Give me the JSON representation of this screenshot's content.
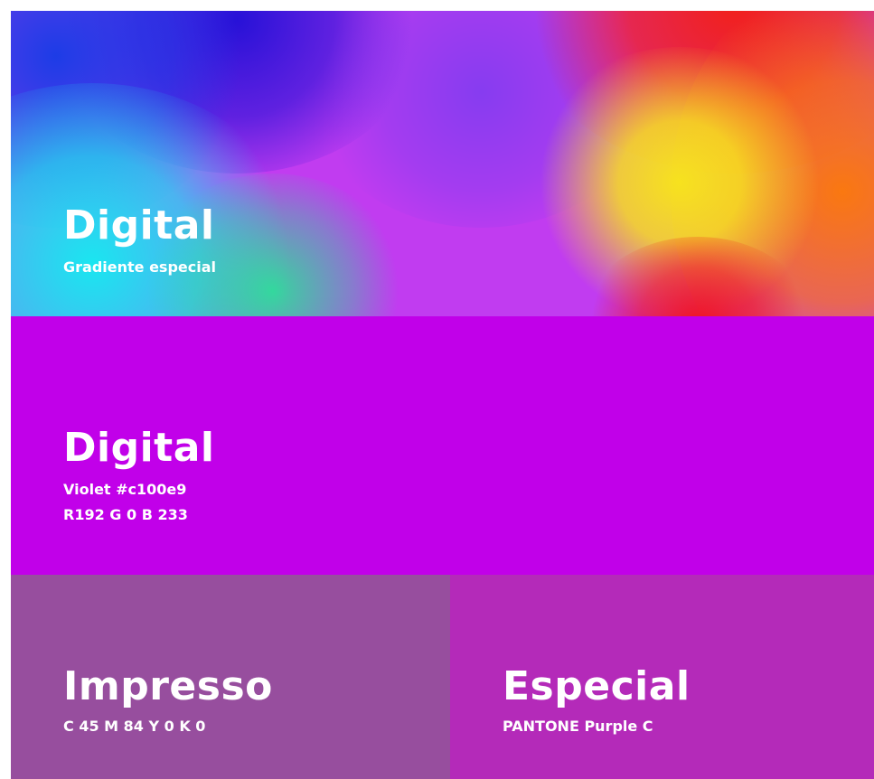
{
  "colors": {
    "violet": "#c100e9",
    "print": "#974e9e",
    "special": "#b42ab9",
    "gradient": [
      "#1f0fd6",
      "#1ae6f0",
      "#1ef08f",
      "#d93cf5",
      "#f2201a",
      "#f7e21e",
      "#fa8a10"
    ]
  },
  "panels": {
    "gradient": {
      "title": "Digital",
      "subtitle": "Gradiente especial"
    },
    "violet": {
      "title": "Digital",
      "hex_line": "Violet #c100e9",
      "rgb_line": "R192 G 0 B 233"
    },
    "print": {
      "title": "Impresso",
      "cmyk_line": "C 45 M 84 Y 0 K 0"
    },
    "special": {
      "title": "Especial",
      "pantone_line": "PANTONE Purple C"
    }
  }
}
